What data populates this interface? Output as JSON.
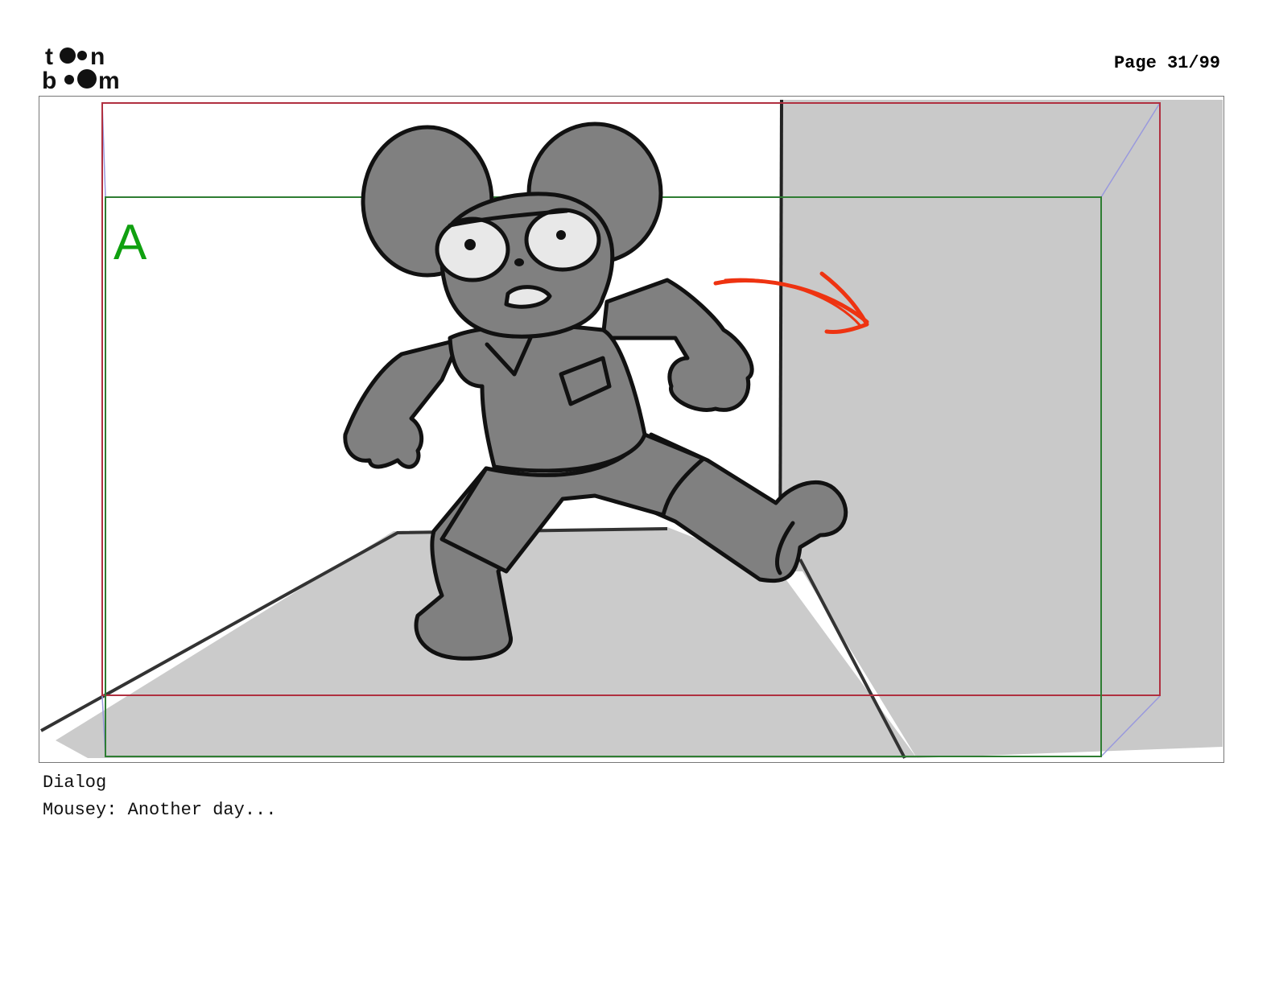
{
  "header": {
    "logo_line1": "toon",
    "logo_line2": "boom",
    "page_label": "Page 31/99"
  },
  "panel": {
    "field_letter": "A",
    "colors": {
      "safe_frame": "#b03040",
      "field_frame": "#2e7d32",
      "arrow": "#ee3311",
      "character": "#808080",
      "wall_shade": "#c9c9c9",
      "ink": "#111111"
    }
  },
  "dialog": {
    "label": "Dialog",
    "text": "Mousey: Another day..."
  }
}
